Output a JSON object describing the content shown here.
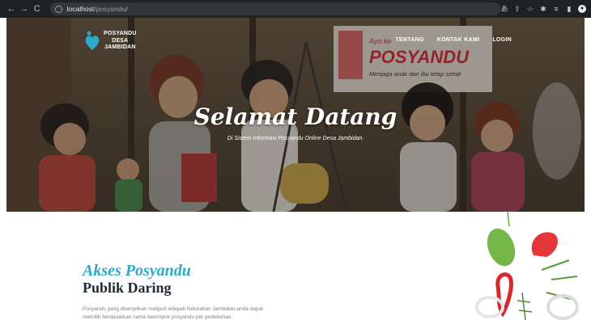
{
  "browser": {
    "url_host": "localhost",
    "url_path": "/posyandu/",
    "back_icon": "back-arrow-icon",
    "forward_icon": "forward-arrow-icon",
    "reload_icon": "reload-icon"
  },
  "nav": {
    "logo_line1": "POSYANDU",
    "logo_line2": "DESA",
    "logo_line3": "JAMBIDAN",
    "items": [
      "TENTANG",
      "KONTAK KAMI",
      "LOGIN"
    ]
  },
  "hero": {
    "title": "Selamat Datang",
    "subtitle": "Di Sistem Informasi Posyandu Online Desa Jambidan.",
    "poster_line1": "Ayo ke",
    "poster_line2": "POSYANDU",
    "poster_line3": "Menjaga anak dan ibu tetap sehat"
  },
  "section": {
    "heading_accent": "Akses Posyandu",
    "heading_main": "Publik Daring",
    "body": "Posyandu yang ditampilkan meliputi wilayah Kelurahan Jambidan,anda dapat memilih berdasarkan nama kelompok posyandu per pedukuhan."
  },
  "colors": {
    "accent": "#2fa9c9",
    "heading": "#1f2a36",
    "poster_red": "#d32f3a"
  }
}
